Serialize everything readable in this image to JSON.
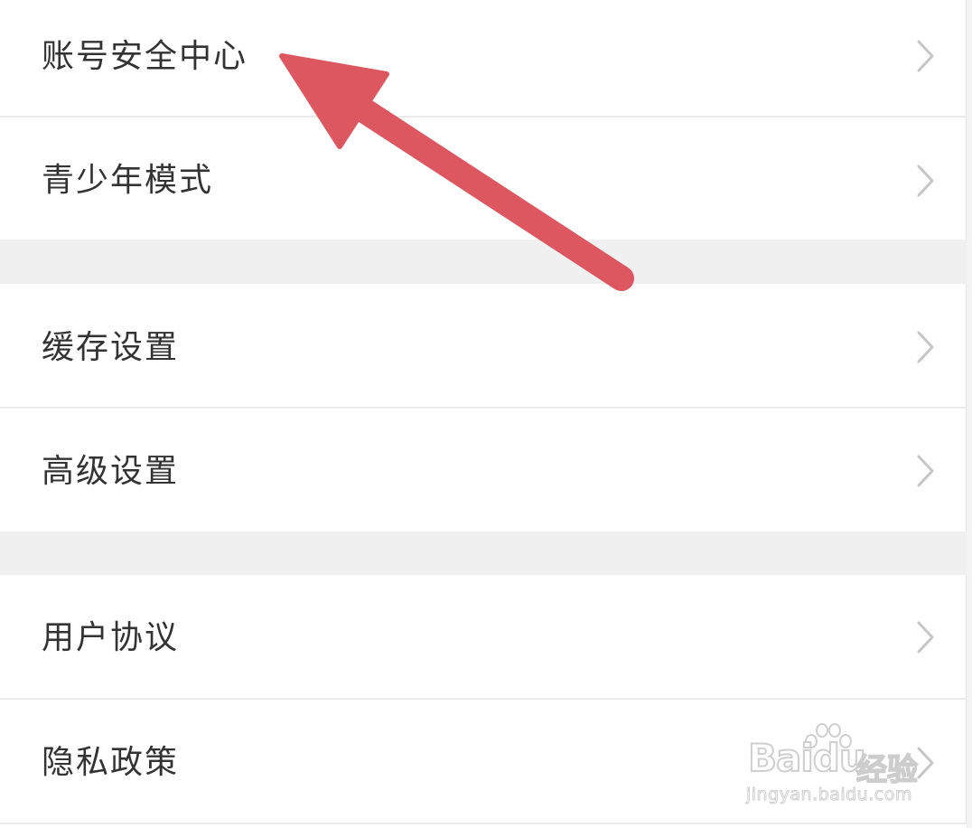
{
  "settings": {
    "items": [
      {
        "label": "账号安全中心"
      },
      {
        "label": "青少年模式"
      },
      {
        "label": "缓存设置"
      },
      {
        "label": "高级设置"
      },
      {
        "label": "用户协议"
      },
      {
        "label": "隐私政策"
      }
    ]
  },
  "icons": {
    "row_chevron": "chevron-right-icon",
    "annotation": "red-arrow-annotation",
    "watermark_paw": "paw-icon"
  },
  "colors": {
    "arrow": "#dd5761",
    "label_text": "#333333",
    "chevron": "#c6c6c6",
    "section_gap": "#f0f0f0",
    "divider": "#ebebeb"
  },
  "watermark": {
    "brand": "Bai",
    "brand_du": "du",
    "product": "经验",
    "url": "jingyan.baidu.com"
  }
}
